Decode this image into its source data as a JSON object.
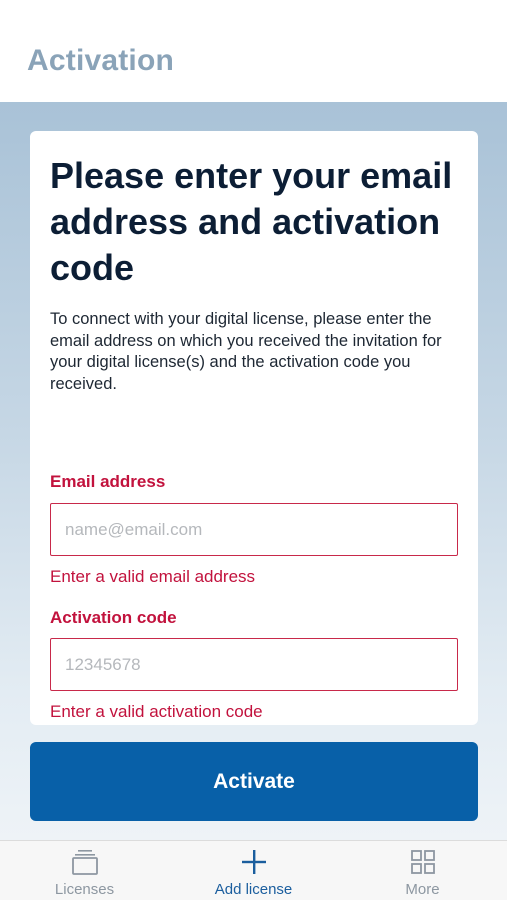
{
  "header": {
    "title": "Activation"
  },
  "card": {
    "heading": "Please enter your email address and activation code",
    "description": "To connect with your digital license, please enter the email address on which you received the invitation for your digital license(s) and the activation code you received."
  },
  "email": {
    "label": "Email address",
    "placeholder": "name@email.com",
    "value": "",
    "error": "Enter a valid email address"
  },
  "activation_code": {
    "label": "Activation code",
    "placeholder": "12345678",
    "value": "",
    "error": "Enter a valid activation code"
  },
  "activate_button": {
    "label": "Activate"
  },
  "tabs": [
    {
      "label": "Licenses",
      "icon": "licenses-icon",
      "active": false
    },
    {
      "label": "Add license",
      "icon": "plus-icon",
      "active": true
    },
    {
      "label": "More",
      "icon": "grid-icon",
      "active": false
    }
  ],
  "colors": {
    "accent": "#0860a8",
    "error": "#c2123d",
    "title_muted": "#8aa3b8",
    "tab_active": "#1b5e9e",
    "tab_inactive": "#8d97a1"
  }
}
